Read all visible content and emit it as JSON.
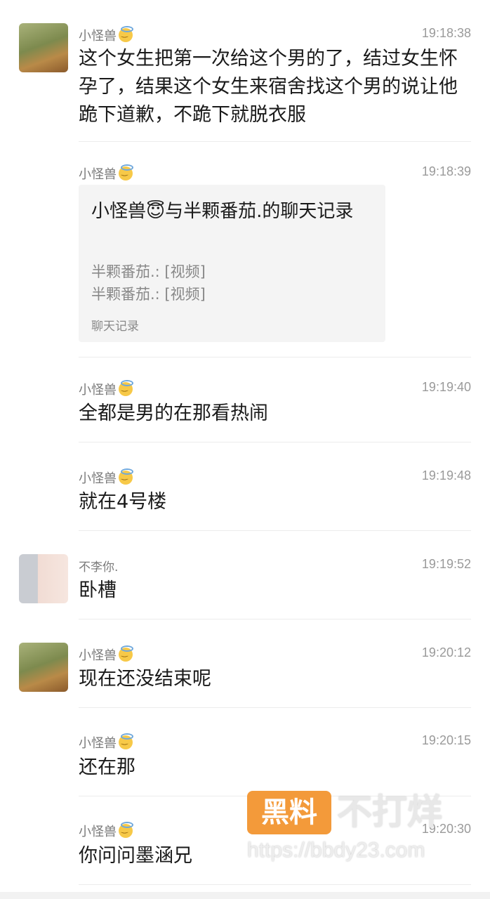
{
  "messages": [
    {
      "sender": "小怪兽",
      "time": "19:18:38",
      "text": "这个女生把第一次给这个男的了，结过女生怀孕了，结果这个女生来宿舍找这个男的说让他跪下道歉，不跪下就脱衣服",
      "avatar": "dog-avatar"
    },
    {
      "sender": "小怪兽",
      "time": "19:18:39",
      "card": {
        "title": "小怪兽😇与半颗番茄.的聊天记录",
        "lines": [
          "半颗番茄.: [视频]",
          "半颗番茄.: [视频]"
        ],
        "footer": "聊天记录"
      }
    },
    {
      "sender": "小怪兽",
      "time": "19:19:40",
      "text": "全都是男的在那看热闹"
    },
    {
      "sender": "小怪兽",
      "time": "19:19:48",
      "text": "就在4号楼"
    },
    {
      "sender": "不李你.",
      "time": "19:19:52",
      "text": "卧槽",
      "avatar": "girl-avatar"
    },
    {
      "sender": "小怪兽",
      "time": "19:20:12",
      "text": "现在还没结束呢",
      "avatar": "dog-avatar"
    },
    {
      "sender": "小怪兽",
      "time": "19:20:15",
      "text": "还在那"
    },
    {
      "sender": "小怪兽",
      "time": "19:20:30",
      "text": "你问问墨涵兄"
    }
  ],
  "watermark": {
    "badge": "黑料",
    "text": "不打烊",
    "url": "https://bbdy23.com"
  },
  "colors": {
    "badge": "#f39a3a",
    "text": "#1a1a1a",
    "meta": "#9a9a9a"
  }
}
